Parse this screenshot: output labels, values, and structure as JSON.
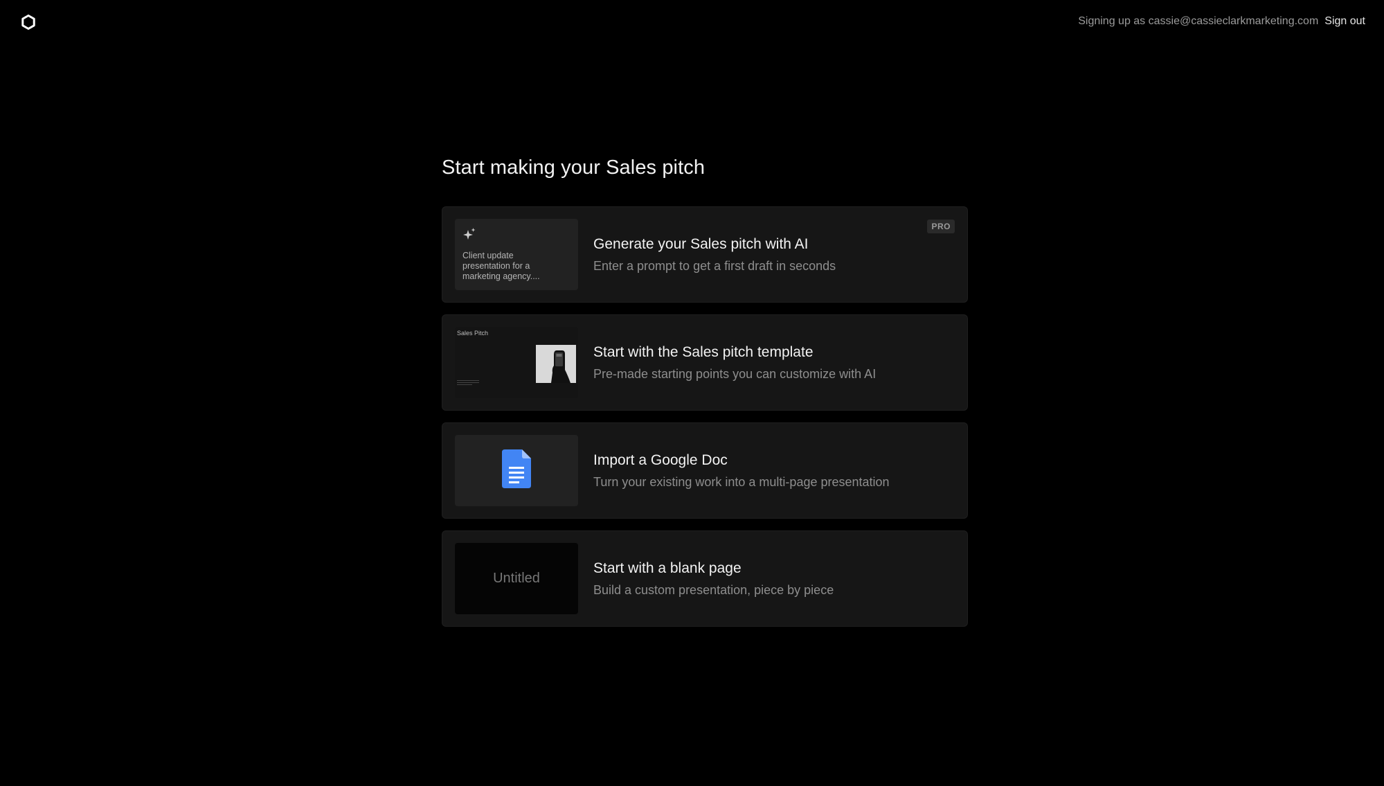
{
  "header": {
    "logo_icon": "logo-ring-icon",
    "signing_up_text": "Signing up as cassie@cassieclarkmarketing.com",
    "sign_out_label": "Sign out"
  },
  "main": {
    "title": "Start making your Sales pitch",
    "cards": [
      {
        "title": "Generate your Sales pitch with AI",
        "description": "Enter a prompt to get a first draft in seconds",
        "badge": "PRO",
        "thumb_prompt": "Client update presentation for a marketing agency....",
        "thumb_icon": "sparkle-icon"
      },
      {
        "title": "Start with the Sales pitch template",
        "description": "Pre-made starting points you can customize with AI",
        "thumb_label": "Sales Pitch"
      },
      {
        "title": "Import a Google Doc",
        "description": "Turn your existing work into a multi-page presentation",
        "thumb_icon": "google-doc-icon"
      },
      {
        "title": "Start with a blank page",
        "description": "Build a custom presentation, piece by piece",
        "thumb_label": "Untitled"
      }
    ]
  },
  "colors": {
    "background": "#000000",
    "card": "#161616",
    "google_doc_blue": "#4285F4"
  }
}
